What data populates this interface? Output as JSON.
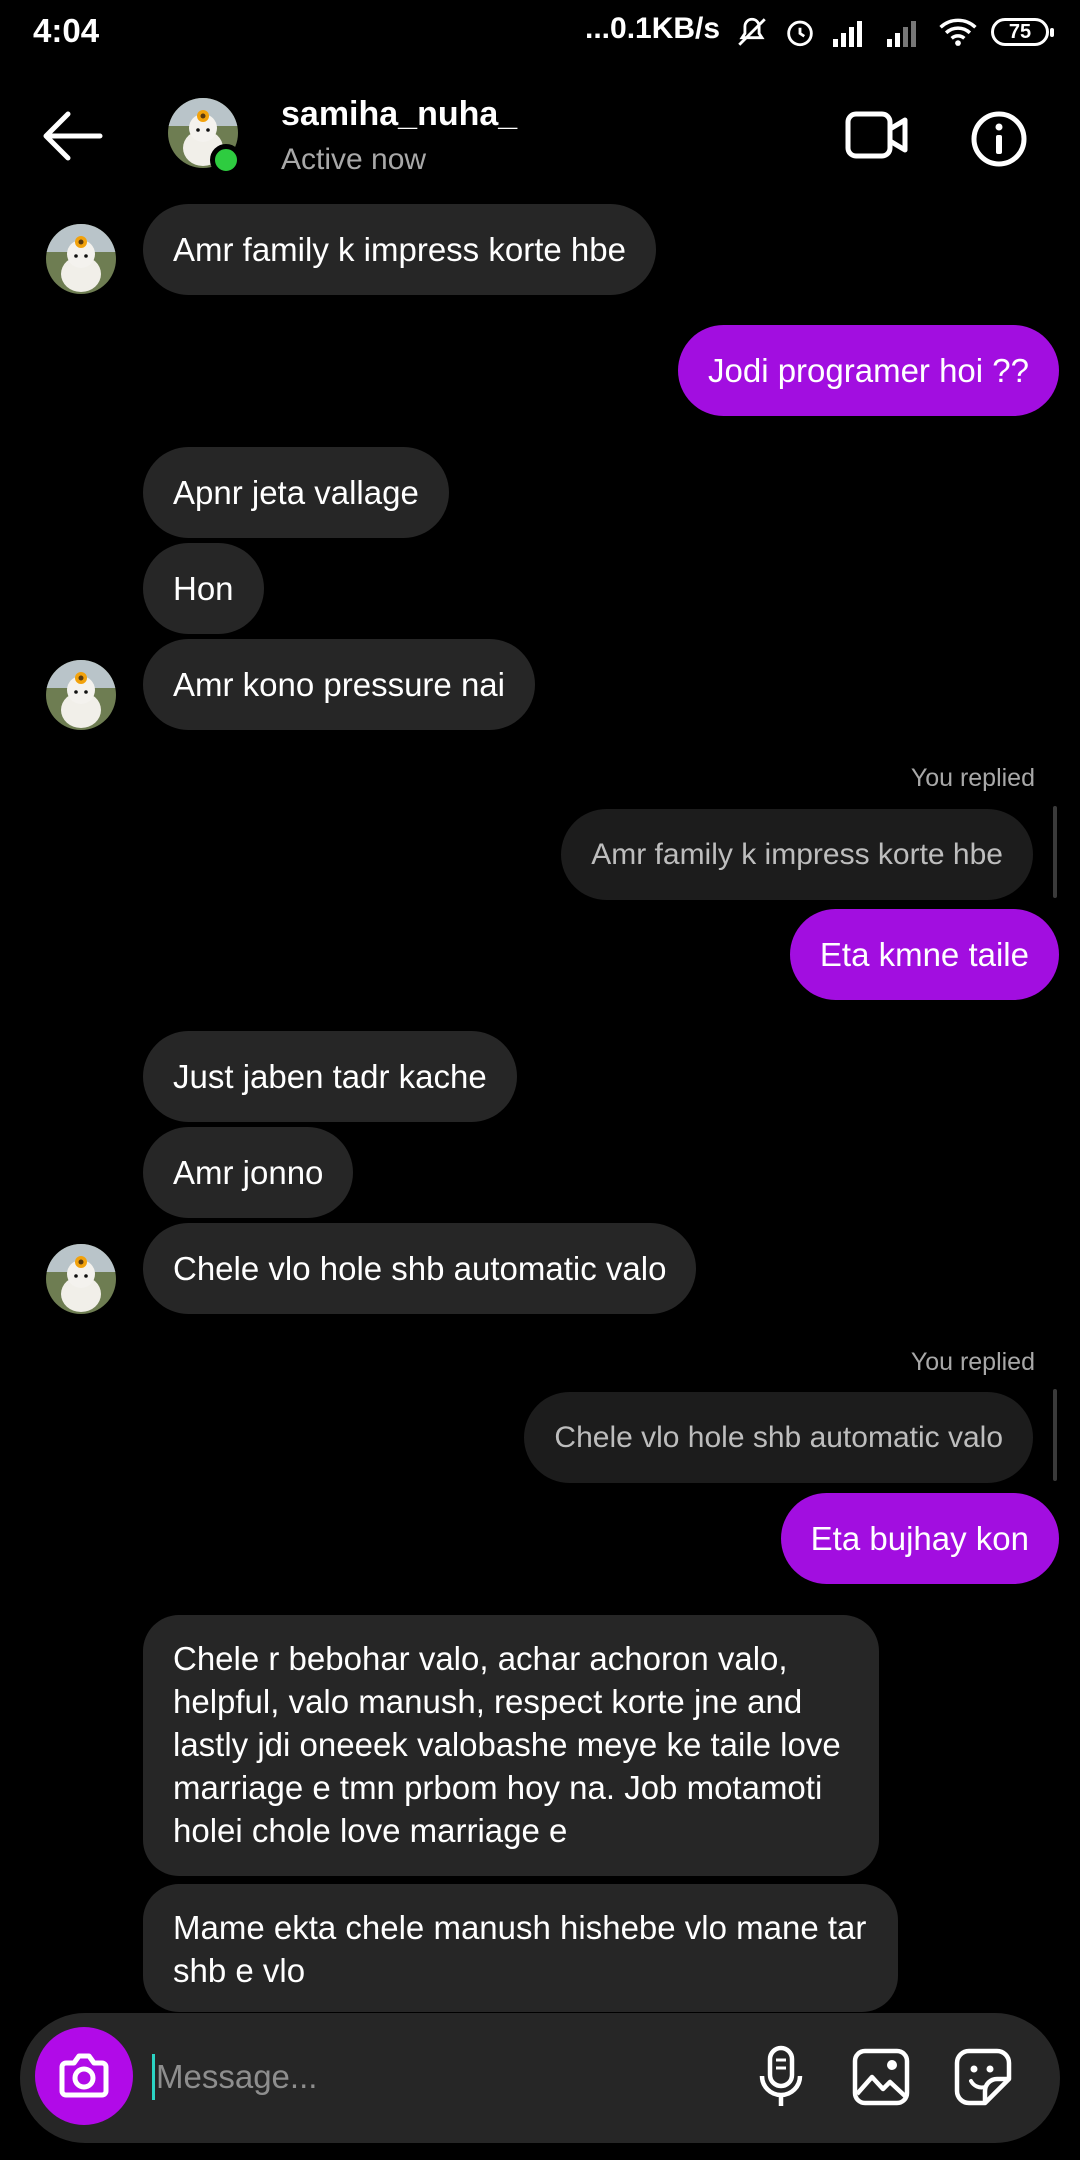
{
  "status_bar": {
    "time": "4:04",
    "speed": "...0.1KB/s",
    "battery": "75"
  },
  "header": {
    "username": "samiha_nuha_",
    "status": "Active now"
  },
  "messages": {
    "m1": "Amr family k impress korte hbe",
    "m2": "Jodi programer hoi ??",
    "m3": "Apnr jeta vallage",
    "m4": "Hon",
    "m5": "Amr kono pressure nai",
    "replied_label_1": "You replied",
    "quoted_1": "Amr family k impress korte hbe",
    "m6": "Eta kmne taile",
    "m7": "Just jaben tadr kache",
    "m8": "Amr jonno",
    "m9": "Chele vlo hole shb automatic valo",
    "replied_label_2": "You replied",
    "quoted_2": "Chele vlo hole shb automatic valo",
    "m10": "Eta bujhay kon",
    "m11": "Chele r bebohar valo, achar achoron valo, helpful, valo manush, respect korte jne and lastly jdi oneeek valobashe meye ke taile love marriage e tmn prbom hoy na. Job motamoti holei chole  love marriage e",
    "m12": "Mame ekta chele manush hishebe vlo mane tar shb e vlo"
  },
  "composer": {
    "placeholder": "Message..."
  },
  "colors": {
    "outgoing_bubble": "#a20ee0",
    "incoming_bubble": "#262626",
    "camera_button": "#b10ae8",
    "online": "#2ecc40"
  },
  "icons": [
    "back-arrow-icon",
    "video-call-icon",
    "info-icon",
    "camera-icon",
    "microphone-icon",
    "gallery-icon",
    "sticker-icon"
  ]
}
